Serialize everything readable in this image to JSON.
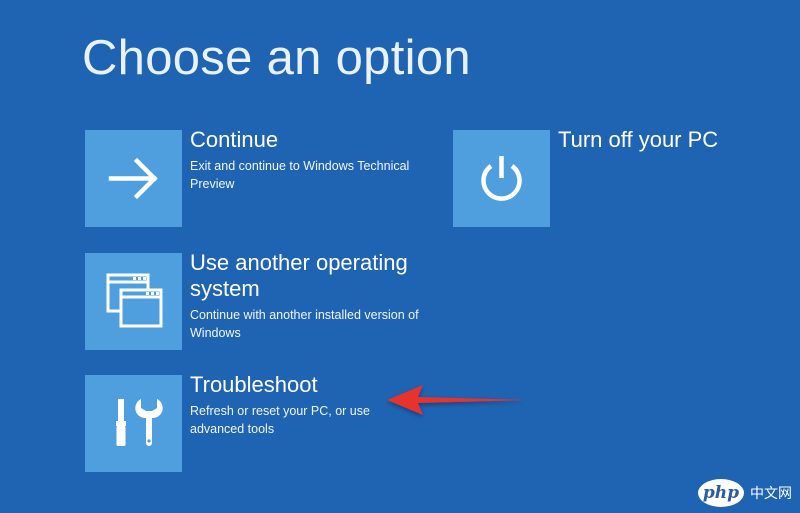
{
  "page": {
    "title": "Choose an option"
  },
  "options": {
    "continue": {
      "title": "Continue",
      "description": "Exit and continue to Windows Technical Preview",
      "icon": "arrow-right-icon"
    },
    "turn_off": {
      "title": "Turn off your PC",
      "description": "",
      "icon": "power-icon"
    },
    "another_os": {
      "title": "Use another operating system",
      "description": "Continue with another installed version of Windows",
      "icon": "windows-stack-icon"
    },
    "troubleshoot": {
      "title": "Troubleshoot",
      "description": "Refresh or reset your PC, or use advanced tools",
      "icon": "tools-icon"
    }
  },
  "annotation": {
    "arrow_color": "#e8322f",
    "points_to": "Troubleshoot"
  },
  "watermark": {
    "logo": "php",
    "text": "中文网"
  },
  "colors": {
    "background": "#1f63b3",
    "tile": "#4f9fdf",
    "text": "#ffffff"
  }
}
